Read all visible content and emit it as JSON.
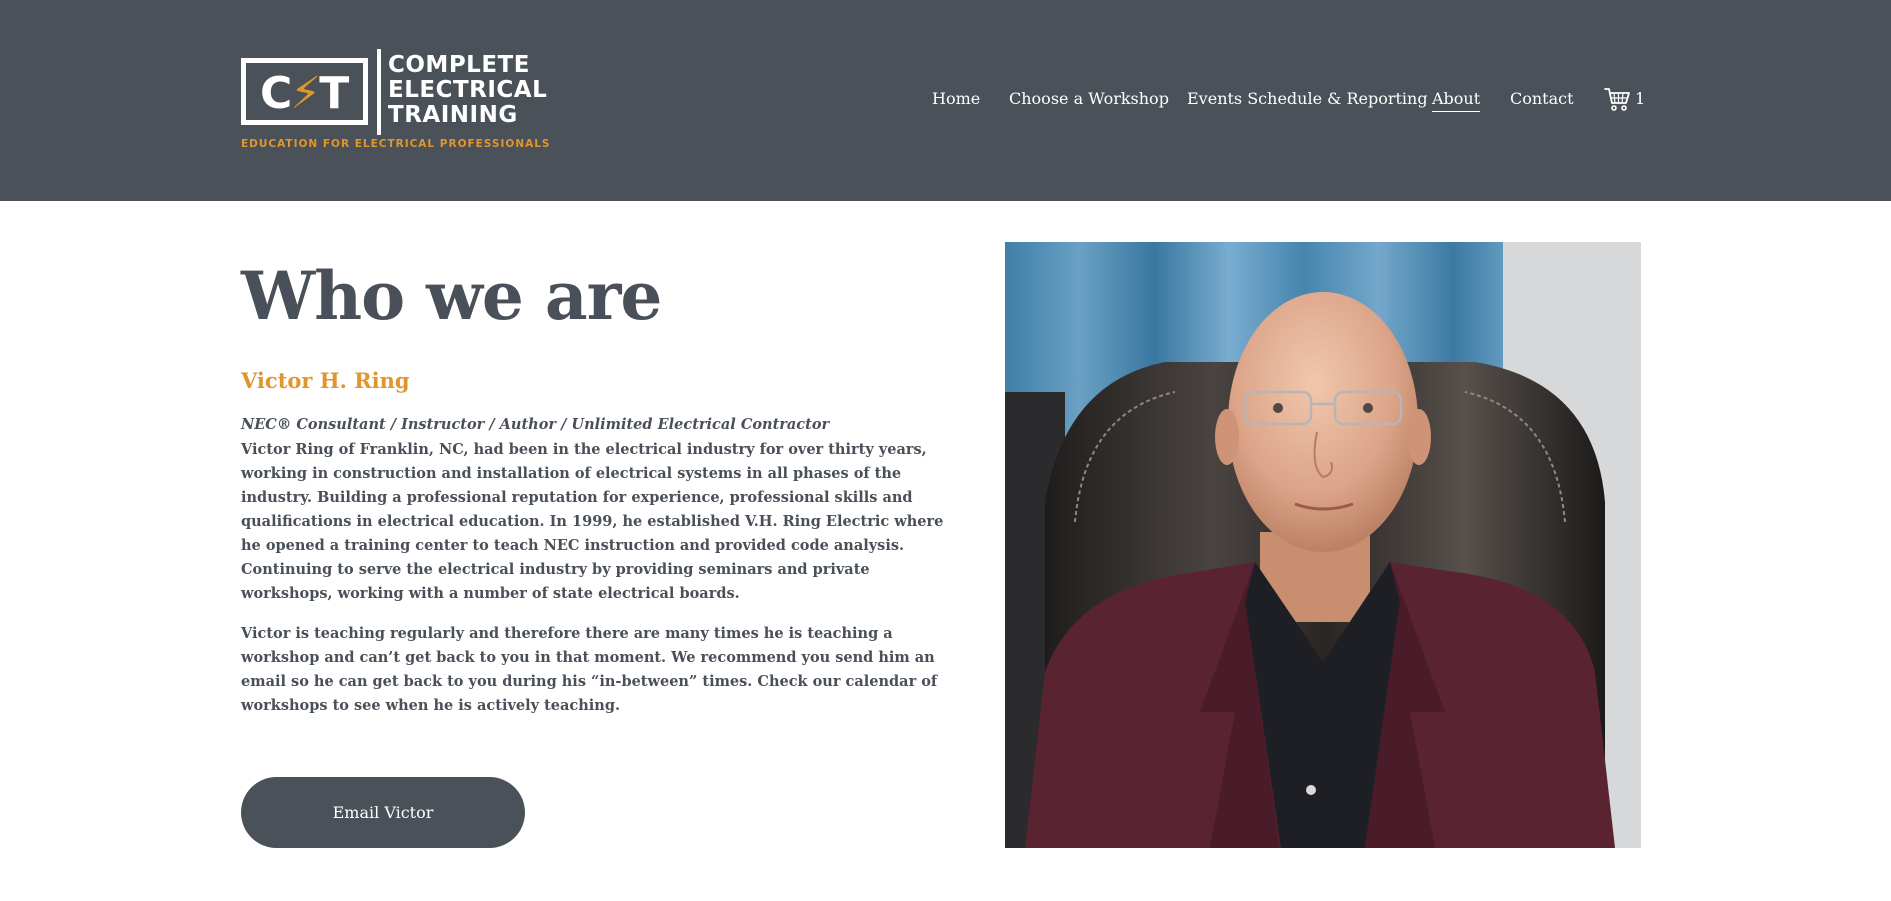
{
  "header": {
    "logo": {
      "letters": "CET",
      "words": [
        "COMPLETE",
        "ELECTRICAL",
        "TRAINING"
      ],
      "tagline": "EDUCATION FOR ELECTRICAL PROFESSIONALS"
    },
    "nav": [
      {
        "label": "Home",
        "active": false
      },
      {
        "label": "Choose a Workshop",
        "active": false
      },
      {
        "label": "Events Schedule & Reporting",
        "active": false
      },
      {
        "label": "About",
        "active": true
      },
      {
        "label": "Contact",
        "active": false
      }
    ],
    "cart": {
      "icon": "cart-icon",
      "count": "1"
    }
  },
  "main": {
    "title": "Who we are",
    "name": "Victor H. Ring",
    "role": "NEC® Consultant / Instructor / Author / Unlimited Electrical Contractor",
    "paragraph1": "Victor Ring of Franklin, NC, had been in the electrical industry for over thirty years, working in construction and  installation of  electrical systems in all phases of the industry.  Building a professional reputation for experience, professional skills and qualifications in electrical education.  In 1999, he established V.H. Ring Electric where he opened a training center to teach NEC instruction and provided code analysis. Continuing to serve the electrical industry by providing seminars and private workshops, working with a number of state electrical boards.",
    "paragraph2": "Victor is teaching regularly and therefore there are many times he is teaching a workshop and can’t get back to you in that moment. We recommend you send him an email so he can get back to you during his “in-between” times. Check our calendar of workshops to see when he is actively teaching.",
    "button": "Email Victor"
  },
  "colors": {
    "header_bg": "#4b5159",
    "accent": "#e0962c",
    "text": "#4a5059"
  }
}
